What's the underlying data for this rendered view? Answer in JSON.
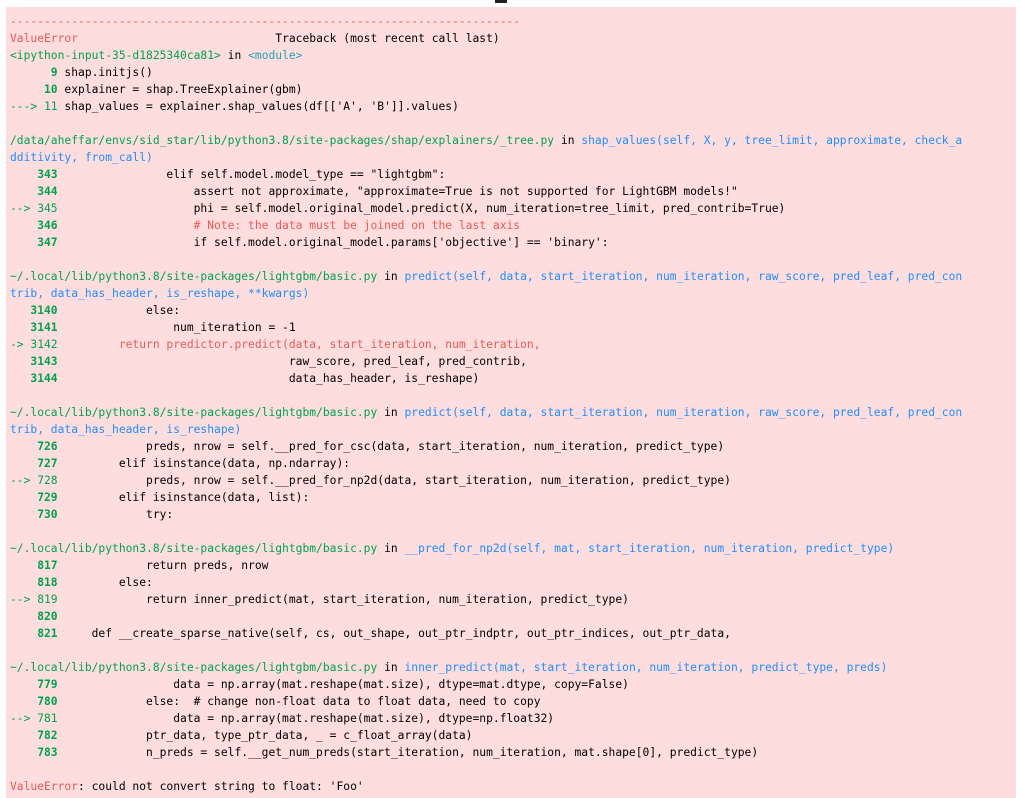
{
  "traceback": {
    "dashes": "---------------------------------------------------------------------------",
    "error_name": "ValueError",
    "header_right": "Traceback (most recent call last)",
    "frame0": {
      "input": "<ipython-input-35-d1825340ca81>",
      "in": " in ",
      "module": "<module>",
      "l9_no": "      9",
      "l9": " shap.initjs()",
      "l10_no": "     10",
      "l10": " explainer = shap.TreeExplainer(gbm)",
      "l11_arrow": "---> 11",
      "l11": " shap_values = explainer.shap_values(df[['A', 'B']].values)"
    },
    "frame1": {
      "path": "/data/aheffar/envs/sid_star/lib/python3.8/site-packages/shap/explainers/_tree.py",
      "in": " in ",
      "sig1": "shap_values(self, X, y, tree_limit, approximate, check_a",
      "sig2": "dditivity, from_call)",
      "l343": "    343",
      "c343": "                elif self.model.model_type == \"lightgbm\":",
      "l344": "    344",
      "c344": "                    assert not approximate, \"approximate=True is not supported for LightGBM models!\"",
      "l345": "--> 345",
      "c345": "                    phi = self.model.original_model.predict(X, num_iteration=tree_limit, pred_contrib=True)",
      "l346": "    346",
      "c346": "                    # Note: the data must be joined on the last axis",
      "l347": "    347",
      "c347": "                    if self.model.original_model.params['objective'] == 'binary':"
    },
    "frame2": {
      "path": "~/.local/lib/python3.8/site-packages/lightgbm/basic.py",
      "in": " in ",
      "sig1": "predict(self, data, start_iteration, num_iteration, raw_score, pred_leaf, pred_con",
      "sig2": "trib, data_has_header, is_reshape, **kwargs)",
      "l3140": "   3140",
      "c3140": "             else:",
      "l3141": "   3141",
      "c3141": "                 num_iteration = -1",
      "l3142": "-> 3142",
      "c3142": "         return predictor.predict(data, start_iteration, num_iteration,",
      "l3143": "   3143",
      "c3143": "                                  raw_score, pred_leaf, pred_contrib,",
      "l3144": "   3144",
      "c3144": "                                  data_has_header, is_reshape)"
    },
    "frame3": {
      "path": "~/.local/lib/python3.8/site-packages/lightgbm/basic.py",
      "in": " in ",
      "sig1": "predict(self, data, start_iteration, num_iteration, raw_score, pred_leaf, pred_con",
      "sig2": "trib, data_has_header, is_reshape)",
      "l726": "    726",
      "c726": "             preds, nrow = self.__pred_for_csc(data, start_iteration, num_iteration, predict_type)",
      "l727": "    727",
      "c727": "         elif isinstance(data, np.ndarray):",
      "l728": "--> 728",
      "c728": "             preds, nrow = self.__pred_for_np2d(data, start_iteration, num_iteration, predict_type)",
      "l729": "    729",
      "c729": "         elif isinstance(data, list):",
      "l730": "    730",
      "c730": "             try:"
    },
    "frame4": {
      "path": "~/.local/lib/python3.8/site-packages/lightgbm/basic.py",
      "in": " in ",
      "sig1": "__pred_for_np2d(self, mat, start_iteration, num_iteration, predict_type)",
      "l817": "    817",
      "c817": "             return preds, nrow",
      "l818": "    818",
      "c818": "         else:",
      "l819": "--> 819",
      "c819": "             return inner_predict(mat, start_iteration, num_iteration, predict_type)",
      "l820": "    820",
      "c820": "",
      "l821": "    821",
      "c821": "     def __create_sparse_native(self, cs, out_shape, out_ptr_indptr, out_ptr_indices, out_ptr_data,"
    },
    "frame5": {
      "path": "~/.local/lib/python3.8/site-packages/lightgbm/basic.py",
      "in": " in ",
      "sig1": "inner_predict(mat, start_iteration, num_iteration, predict_type, preds)",
      "l779": "    779",
      "c779": "                 data = np.array(mat.reshape(mat.size), dtype=mat.dtype, copy=False)",
      "l780": "    780",
      "c780": "             else:  # change non-float data to float data, need to copy",
      "l781": "--> 781",
      "c781": "                 data = np.array(mat.reshape(mat.size), dtype=np.float32)",
      "l782": "    782",
      "c782": "             ptr_data, type_ptr_data, _ = c_float_array(data)",
      "l783": "    783",
      "c783": "             n_preds = self.__get_num_preds(start_iteration, num_iteration, mat.shape[0], predict_type)"
    },
    "final_error_name": "ValueError",
    "final_message": ": could not convert string to float: 'Foo'"
  }
}
